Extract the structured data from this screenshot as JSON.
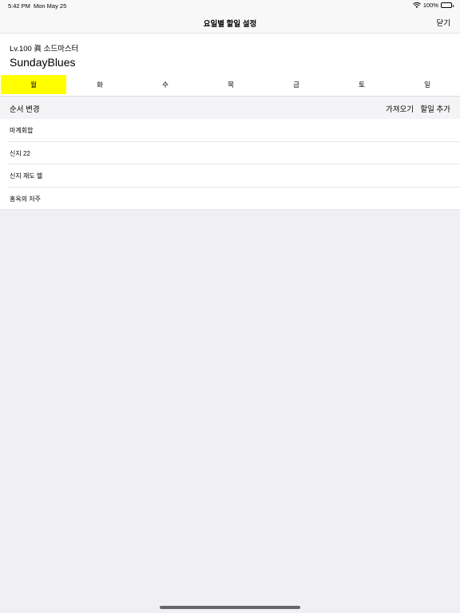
{
  "status_bar": {
    "time": "5:42 PM",
    "date": "Mon May 25",
    "battery": "100%"
  },
  "nav": {
    "title": "요일별 할일 설정",
    "close_label": "닫기"
  },
  "header": {
    "level": "Lv.100 眞 소드마스터",
    "name": "SundayBlues"
  },
  "days": [
    "월",
    "화",
    "수",
    "목",
    "금",
    "토",
    "일"
  ],
  "selected_day_index": 0,
  "colors": {
    "selected_tab": "#ffff00"
  },
  "toolbar": {
    "reorder_label": "순서 변경",
    "import_label": "가져오기",
    "add_label": "할일 추가"
  },
  "tasks": [
    "마계회합",
    "신지 22",
    "신지 재도 헬",
    "홍옥의 저주"
  ]
}
